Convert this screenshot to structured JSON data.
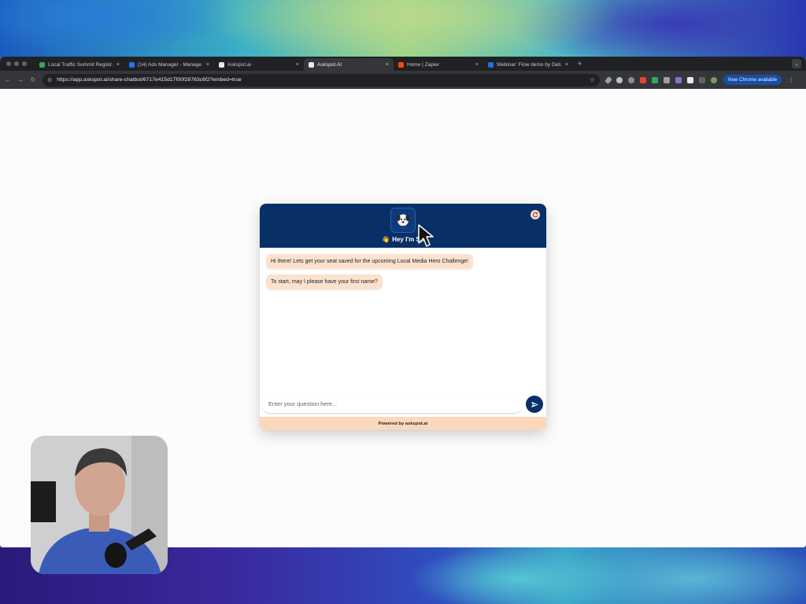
{
  "browser": {
    "tabs": [
      {
        "title": "Local Traffic Summit Registr...",
        "favicon_color": "#34a853",
        "active": false
      },
      {
        "title": "(14) Ads Manager - Manage a...",
        "favicon_color": "#1877f2",
        "active": false
      },
      {
        "title": "Askspot.ai",
        "favicon_color": "#e8eaed",
        "active": false
      },
      {
        "title": "Askspot.AI",
        "favicon_color": "#e8eaed",
        "active": true
      },
      {
        "title": "Home | Zapier",
        "favicon_color": "#ff4a00",
        "active": false
      },
      {
        "title": "Webinar: Flow demo by Deli...",
        "favicon_color": "#1a73e8",
        "active": false
      }
    ],
    "url": "https://app.askspot.ai/share-chatbot/6717e415d17f00f28763c6f2?embed=true",
    "update_button": "New Chrome available"
  },
  "chatbot": {
    "greeting_emoji": "👋",
    "greeting": "Hey I'm Sp",
    "messages": [
      {
        "text": "Hi there! Lets get your seat saved for the upcoming Local Media Hero Challenge!"
      },
      {
        "text": "To start, may I please have your first name?"
      }
    ],
    "input_placeholder": "Enter your question here...",
    "footer": "Powered by askspot.ai",
    "colors": {
      "header": "#082f66",
      "bubble": "#fbe2cf",
      "footer": "#fbd8bc"
    }
  },
  "icons": {
    "refresh": "refresh-icon",
    "send": "send-icon",
    "cursor": "mouse-pointer"
  }
}
